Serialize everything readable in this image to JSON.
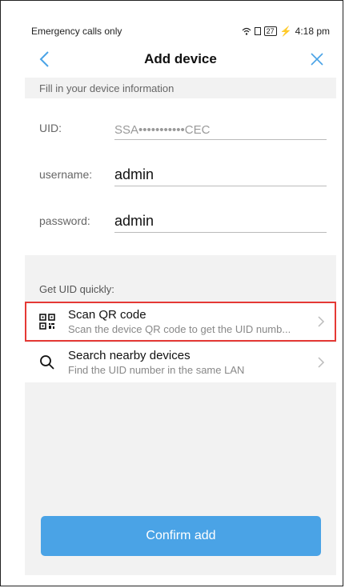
{
  "status_bar": {
    "carrier": "Emergency calls only",
    "battery": "27",
    "time": "4:18 pm"
  },
  "nav": {
    "title": "Add device",
    "back_icon": "chevron-left-icon",
    "close_icon": "close-icon"
  },
  "form": {
    "section_label": "Fill in your device information",
    "uid_label": "UID:",
    "uid_value": "SSA•••••••••••CEC",
    "username_label": "username:",
    "username_value": "admin",
    "password_label": "password:",
    "password_value": "admin"
  },
  "quick": {
    "header": "Get UID quickly:",
    "options": [
      {
        "title": "Scan QR code",
        "subtitle": "Scan the device QR code to get the UID numb...",
        "icon": "qr-code-icon"
      },
      {
        "title": "Search nearby devices",
        "subtitle": "Find the UID number in the same LAN",
        "icon": "search-icon"
      }
    ]
  },
  "confirm_label": "Confirm add",
  "colors": {
    "accent": "#4aa3e6",
    "highlight": "#e53935",
    "background": "#f2f2f2"
  }
}
